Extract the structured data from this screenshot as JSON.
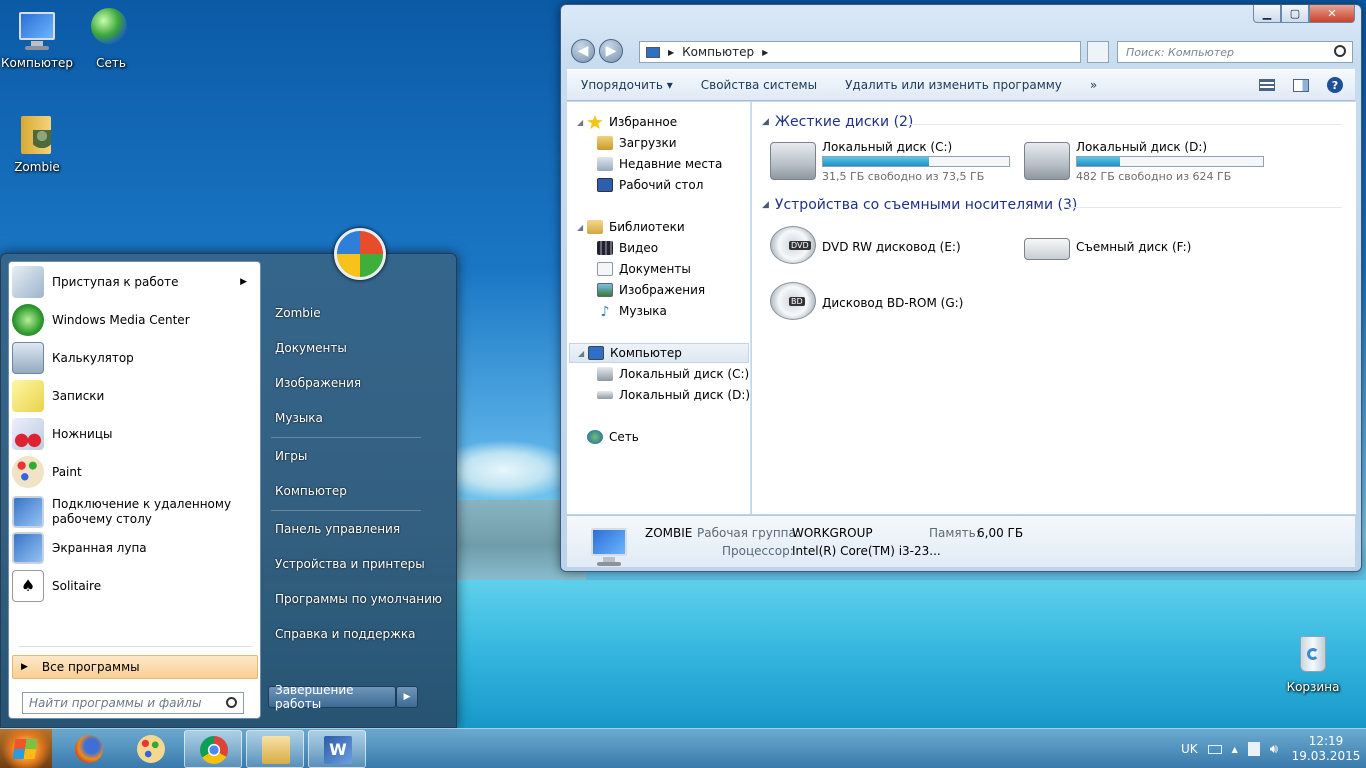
{
  "desktop": {
    "icons": [
      {
        "label": "Компьютер",
        "icon": "computer-icon"
      },
      {
        "label": "Сеть",
        "icon": "network-icon"
      },
      {
        "label": "Zombie",
        "icon": "user-folder-icon"
      },
      {
        "label": "Корзина",
        "icon": "recycle-bin-icon"
      }
    ]
  },
  "explorer": {
    "controls": {
      "minimize": "▁",
      "maximize": "▢",
      "close": "✕"
    },
    "nav": {
      "back": "◀",
      "forward": "▶"
    },
    "address": {
      "path": "Компьютер",
      "separator": "▶"
    },
    "search_placeholder": "Поиск: Компьютер",
    "commands": {
      "organize": "Упорядочить ▾",
      "system_properties": "Свойства системы",
      "uninstall": "Удалить или изменить программу",
      "more": "»"
    },
    "navpane": {
      "favorites": "Избранное",
      "downloads": "Загрузки",
      "recent": "Недавние места",
      "desktop": "Рабочий стол",
      "libraries": "Библиотеки",
      "video": "Видео",
      "documents": "Документы",
      "pictures": "Изображения",
      "music": "Музыка",
      "computer": "Компьютер",
      "disk_c": "Локальный диск (C:)",
      "disk_d": "Локальный диск (D:)",
      "network": "Сеть"
    },
    "groups": {
      "hard_disks": "Жесткие диски (2)",
      "removable": "Устройства со съемными носителями (3)"
    },
    "drives": [
      {
        "name": "Локальный диск (C:)",
        "free": "31,5 ГБ свободно из 73,5 ГБ",
        "used_fraction": 0.57
      },
      {
        "name": "Локальный диск (D:)",
        "free": "482 ГБ свободно из 624 ГБ",
        "used_fraction": 0.23
      }
    ],
    "removable": [
      {
        "name": "DVD RW дисковод (E:)",
        "badge": "DVD"
      },
      {
        "name": "Съемный диск (F:)"
      },
      {
        "name": "Дисковод BD-ROM (G:)",
        "badge": "BD"
      }
    ],
    "details": {
      "name": "ZOMBIE",
      "workgroup_label": "Рабочая группа:",
      "workgroup": "WORKGROUP",
      "memory_label": "Память:",
      "memory": "6,00 ГБ",
      "cpu_label": "Процессор:",
      "cpu": "Intel(R) Core(TM) i3-23..."
    }
  },
  "startmenu": {
    "programs": [
      {
        "label": "Приступая к работе",
        "icon": "getting-started-icon",
        "submenu": "▶"
      },
      {
        "label": "Windows Media Center",
        "icon": "media-center-icon"
      },
      {
        "label": "Калькулятор",
        "icon": "calculator-icon"
      },
      {
        "label": "Записки",
        "icon": "sticky-notes-icon"
      },
      {
        "label": "Ножницы",
        "icon": "scissors-icon"
      },
      {
        "label": "Paint",
        "icon": "paint-icon"
      },
      {
        "label": "Подключение к удаленному рабочему столу",
        "icon": "remote-desktop-icon"
      },
      {
        "label": "Экранная лупа",
        "icon": "magnifier-icon"
      },
      {
        "label": "Solitaire",
        "icon": "solitaire-icon"
      }
    ],
    "all_programs": "Все программы",
    "search_placeholder": "Найти программы и файлы",
    "right": {
      "user": "Zombie",
      "documents": "Документы",
      "pictures": "Изображения",
      "music": "Музыка",
      "games": "Игры",
      "computer": "Компьютер",
      "control_panel": "Панель управления",
      "devices": "Устройства и принтеры",
      "defaults": "Программы по умолчанию",
      "help": "Справка и поддержка"
    },
    "shutdown": "Завершение работы",
    "shutdown_arrow": "▶"
  },
  "taskbar": {
    "start_icon": "windows-start-icon",
    "pinned": [
      "firefox-icon",
      "paint-icon",
      "chrome-icon",
      "explorer-icon",
      "word-icon"
    ],
    "language": "UK",
    "tray_arrow": "▲",
    "time": "12:19",
    "date": "19.03.2015"
  }
}
